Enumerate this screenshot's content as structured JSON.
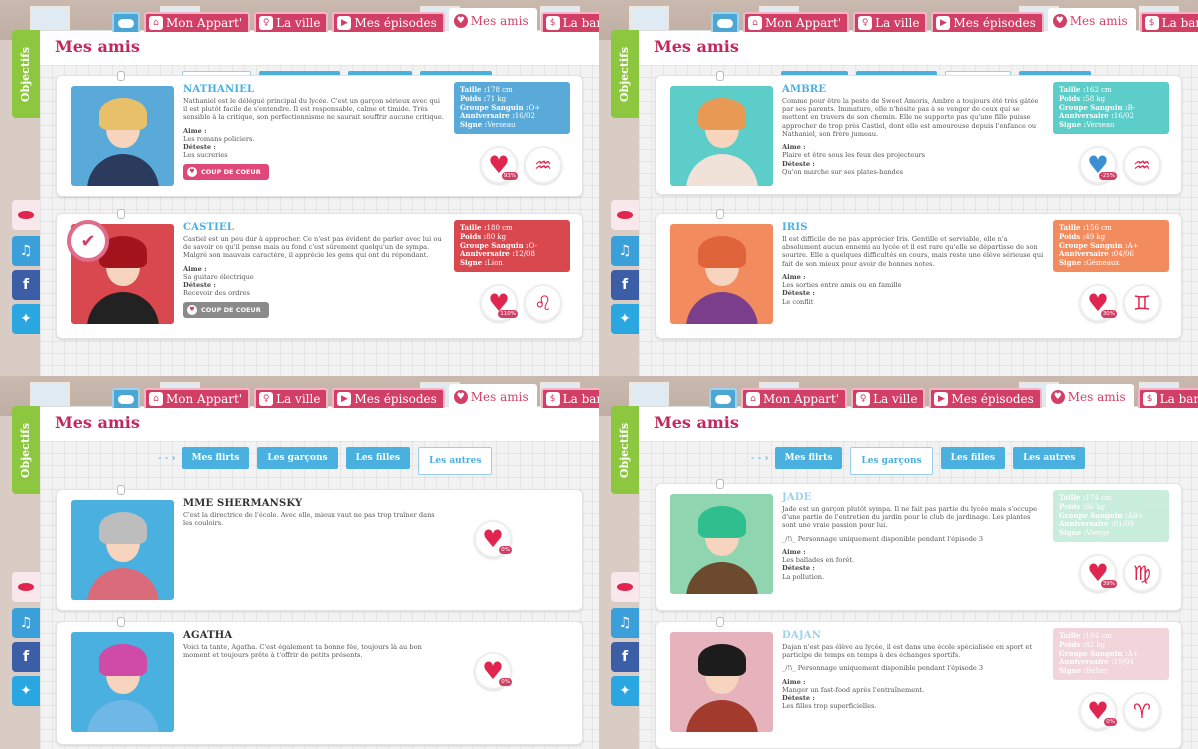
{
  "nav": {
    "tabs": [
      "Mon Appart'",
      "La ville",
      "Mes épisodes",
      "Mes amis",
      "La banque"
    ],
    "active_tab": "Mes amis"
  },
  "sidebar": {
    "objectifs": "Objectifs"
  },
  "page_title": "Mes amis",
  "subtabs": [
    "Mes flirts",
    "Les garçons",
    "Les filles",
    "Les autres"
  ],
  "panels": [
    {
      "active_subtab": "Mes flirts",
      "cards": [
        {
          "name": "NATHANIEL",
          "description": "Nathaniel est le délégué principal du lycée. C'est un garçon sérieux avec qui il est plutôt facile de s'entendre. Il est responsable, calme et timide. Très sensible à la critique, son perfectionnisme ne saurait souffrir aucune critique.",
          "note": "",
          "aime_label": "Aime :",
          "aime": "Les romans policiers.",
          "deteste_label": "Déteste :",
          "deteste": "Les sucreries",
          "button": "COUP DE COEUR",
          "button_active": true,
          "info": {
            "taille": "178 cm",
            "poids": "71 kg",
            "groupe": "O+",
            "anniversaire": "16/02",
            "signe": "Verseau"
          },
          "affinity": "93%",
          "sign_symbol": "♒",
          "heart_broken": false,
          "color": "#5aaad9",
          "portrait_bg": "#5aaad9",
          "hair": "#e9c06a",
          "outfit": "#2b3b5e",
          "badge": false
        },
        {
          "name": "CASTIEL",
          "description": "Castiel est un peu dur à approcher. Ce n'est pas évident de parler avec lui ou de savoir ce qu'il pense mais au fond c'est sûrement quelqu'un de sympa. Malgré son mauvais caractère, il apprécie les gens qui ont du répondant.",
          "note": "",
          "aime_label": "Aime :",
          "aime": "Sa guitare électrique",
          "deteste_label": "Déteste :",
          "deteste": "Recevoir des ordres",
          "button": "COUP DE COEUR",
          "button_active": false,
          "info": {
            "taille": "180 cm",
            "poids": "80 kg",
            "groupe": "O-",
            "anniversaire": "12/08",
            "signe": "Lion"
          },
          "affinity": "110%",
          "sign_symbol": "♌",
          "heart_broken": false,
          "color": "#d9484e",
          "portrait_bg": "#d9484e",
          "hair": "#a3141c",
          "outfit": "#222222",
          "badge": true
        }
      ]
    },
    {
      "active_subtab": "Les filles",
      "cards": [
        {
          "name": "AMBRE",
          "description": "Comme pour être la peste de Sweet Amoris, Ambre a toujours été très gâtée par ses parents. Immature, elle n'hésite pas à se venger de ceux qui se mettent en travers de son chemin. Elle ne supporte pas qu'une fille puisse approcher de trop près Castiel, dont elle est amoureuse depuis l'enfance ou Nathaniel, son frère jumeau.",
          "note": "",
          "aime_label": "Aime :",
          "aime": "Plaire et être sous les feux des projecteurs",
          "deteste_label": "Déteste :",
          "deteste": "Qu'on marche sur ses plates-bandes",
          "button": "",
          "button_active": false,
          "info": {
            "taille": "162 cm",
            "poids": "58 kg",
            "groupe": "B-",
            "anniversaire": "16/02",
            "signe": "Verseau"
          },
          "affinity": "-25%",
          "sign_symbol": "♒",
          "heart_broken": true,
          "color": "#5ccdc8",
          "portrait_bg": "#5ccdc8",
          "hair": "#e89a55",
          "outfit": "#f0e2d8",
          "badge": false
        },
        {
          "name": "IRIS",
          "description": "Il est difficile de ne pas apprécier Iris. Gentille et serviable, elle n'a absolument aucun ennemi au lycée et il est rare qu'elle se départisse de son sourire. Elle a quelques difficultés en cours, mais reste une élève sérieuse qui fait de son mieux pour avoir de bonnes notes.",
          "note": "",
          "aime_label": "Aime :",
          "aime": "Les sorties entre amis ou en famille",
          "deteste_label": "Déteste :",
          "deteste": "Le conflit",
          "button": "",
          "button_active": false,
          "info": {
            "taille": "156 cm",
            "poids": "49 kg",
            "groupe": "A+",
            "anniversaire": "04/06",
            "signe": "Gémeaux"
          },
          "affinity": "30%",
          "sign_symbol": "♊",
          "heart_broken": false,
          "color": "#f28c5e",
          "portrait_bg": "#f28c5e",
          "hair": "#e0643a",
          "outfit": "#7a3e8a",
          "badge": false
        }
      ]
    },
    {
      "active_subtab": "Les autres",
      "cards": [
        {
          "name": "MME SHERMANSKY",
          "description": "C'est la directrice de l'école. Avec elle, mieux vaut ne pas trop traîner dans les couloirs.",
          "note": "",
          "aime_label": "",
          "aime": "",
          "deteste_label": "",
          "deteste": "",
          "button": "",
          "button_active": false,
          "info": null,
          "affinity": "0%",
          "sign_symbol": "",
          "heart_broken": false,
          "color": "#4ab0df",
          "portrait_bg": "#4ab0df",
          "hair": "#bdbdbd",
          "outfit": "#d96b7a",
          "badge": false
        },
        {
          "name": "AGATHA",
          "description": "Voici ta tante, Agatha. C'est également ta bonne fée, toujours là au bon moment et toujours prête à t'offrir de petits présents.",
          "note": "",
          "aime_label": "",
          "aime": "",
          "deteste_label": "",
          "deteste": "",
          "button": "",
          "button_active": false,
          "info": null,
          "affinity": "0%",
          "sign_symbol": "",
          "heart_broken": false,
          "color": "#4ab0df",
          "portrait_bg": "#4ab0df",
          "hair": "#d04ba7",
          "outfit": "#6fb7e6",
          "badge": false
        }
      ]
    },
    {
      "active_subtab": "Les garçons",
      "cards": [
        {
          "name": "JADE",
          "description": "Jade est un garçon plutôt sympa. Il ne fait pas partie du lycée mais s'occupe d'une partie de l'entretien du jardin pour le club de jardinage. Les plantes sont une vraie passion pour lui.",
          "note": "_/!\\_ Personnage uniquement disponible pendant l'épisode 3",
          "aime_label": "Aime :",
          "aime": "Les ballades en forêt.",
          "deteste_label": "Déteste :",
          "deteste": "La pollution.",
          "button": "",
          "button_active": false,
          "info": {
            "taille": "174 cm",
            "poids": "66 kg",
            "groupe": "AB+",
            "anniversaire": "01/09",
            "signe": "Vierge"
          },
          "affinity": "39%",
          "sign_symbol": "♍",
          "heart_broken": false,
          "color": "#9ee0be",
          "portrait_bg": "#8fd6b0",
          "hair": "#2fbf8f",
          "outfit": "#6b4a2e",
          "badge": false,
          "dim": true
        },
        {
          "name": "DAJAN",
          "description": "Dajan n'est pas élève au lycée, il est dans une école spécialisée en sport et participe de temps en temps à des échanges sportifs.",
          "note": "_/!\\_ Personnage uniquement disponible pendant l'épisode 3",
          "aime_label": "Aime :",
          "aime": "Manger un fast-food après l'entraînement.",
          "deteste_label": "Déteste :",
          "deteste": "Les filles trop superficielles.",
          "button": "",
          "button_active": false,
          "info": {
            "taille": "184 cm",
            "poids": "82 kg",
            "groupe": "A+",
            "anniversaire": "19/04",
            "signe": "Bélier"
          },
          "affinity": "0%",
          "sign_symbol": "♈",
          "heart_broken": false,
          "color": "#e6b3bd",
          "portrait_bg": "#e6b3bd",
          "hair": "#1c1c1c",
          "outfit": "#a23a2e",
          "badge": false,
          "dim": true
        }
      ]
    }
  ],
  "labels": {
    "taille": "Taille :",
    "poids": "Poids :",
    "groupe": "Groupe Sanguin :",
    "anniversaire": "Anniversaire :",
    "signe": "Signe :"
  },
  "colors": {
    "accent": "#d23f66",
    "tab_blue": "#4ab0df",
    "objectifs_green": "#8dc63f"
  }
}
